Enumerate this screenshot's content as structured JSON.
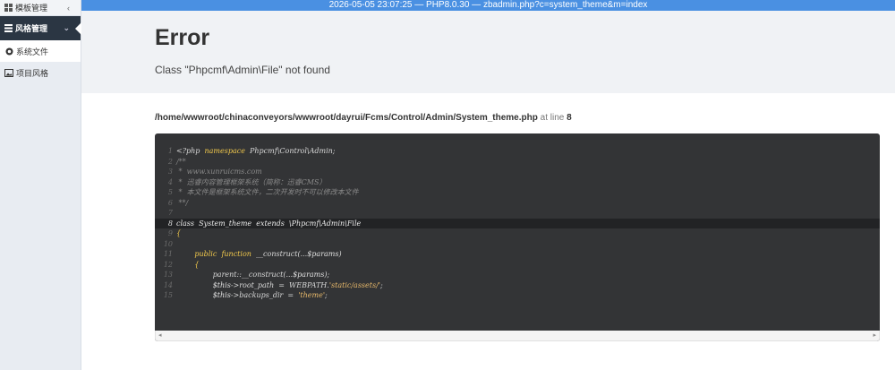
{
  "topbar": {
    "text": "2026-05-05 23:07:25 — PHP8.0.30 — zbadmin.php?c=system_theme&m=index"
  },
  "sidebar": {
    "top": {
      "label": "模板管理"
    },
    "active": {
      "label": "风格管理"
    },
    "items": [
      {
        "label": "系统文件"
      },
      {
        "label": "项目风格"
      }
    ]
  },
  "error": {
    "title": "Error",
    "message": "Class \"Phpcmf\\Admin\\File\" not found"
  },
  "location": {
    "path": "/home/wwwroot/chinaconveyors/wwwroot/dayrui/Fcms/Control/Admin/System_theme.php",
    "at_line_text": "at line",
    "line": "8"
  },
  "code": {
    "lines": [
      {
        "n": "1",
        "parts": [
          [
            "",
            "<?php  "
          ],
          [
            "kw",
            "namespace"
          ],
          [
            "",
            "  Phpcmf\\Control\\Admin;"
          ]
        ]
      },
      {
        "n": "2",
        "parts": [
          [
            "cm",
            "/**"
          ]
        ]
      },
      {
        "n": "3",
        "parts": [
          [
            "cm",
            " *  www.xunruicms.com"
          ]
        ]
      },
      {
        "n": "4",
        "parts": [
          [
            "cm",
            " *  迅睿内容管理框架系统（简称：迅睿CMS）"
          ]
        ]
      },
      {
        "n": "5",
        "parts": [
          [
            "cm",
            " *  本文件是框架系统文件，二次开发时不可以修改本文件"
          ]
        ]
      },
      {
        "n": "6",
        "parts": [
          [
            "cm",
            " **/"
          ]
        ]
      },
      {
        "n": "7",
        "parts": [
          [
            "",
            ""
          ]
        ]
      },
      {
        "n": "8",
        "hl": true,
        "parts": [
          [
            "",
            "class  System_theme  extends  \\Phpcmf\\Admin\\File"
          ]
        ]
      },
      {
        "n": "9",
        "parts": [
          [
            "kw",
            "{"
          ]
        ]
      },
      {
        "n": "10",
        "parts": [
          [
            "",
            ""
          ]
        ]
      },
      {
        "n": "11",
        "parts": [
          [
            "",
            "        "
          ],
          [
            "kw",
            "public"
          ],
          [
            "",
            "  "
          ],
          [
            "kw",
            "function"
          ],
          [
            "",
            "  __construct(..."
          ],
          [
            "var",
            "$params"
          ],
          [
            "",
            ")"
          ]
        ]
      },
      {
        "n": "12",
        "parts": [
          [
            "",
            "        "
          ],
          [
            "kw",
            "{"
          ]
        ]
      },
      {
        "n": "13",
        "parts": [
          [
            "",
            "                parent::__construct(..."
          ],
          [
            "var",
            "$params"
          ],
          [
            "",
            ");"
          ]
        ]
      },
      {
        "n": "14",
        "parts": [
          [
            "",
            "                "
          ],
          [
            "var",
            "$this"
          ],
          [
            "",
            "->root_path  =  WEBPATH."
          ],
          [
            "st",
            "'static/assets/'"
          ],
          [
            "",
            ";"
          ]
        ]
      },
      {
        "n": "15",
        "parts": [
          [
            "",
            "                "
          ],
          [
            "var",
            "$this"
          ],
          [
            "",
            "->backups_dir  =  "
          ],
          [
            "st",
            "'theme'"
          ],
          [
            "",
            ";"
          ]
        ]
      }
    ]
  },
  "icons": {
    "top": "grid-icon",
    "active": "layout-icon",
    "item0": "globe-icon",
    "item1": "image-icon",
    "top_chev": "chevron-left-icon",
    "active_chev": "chevron-down-icon"
  }
}
